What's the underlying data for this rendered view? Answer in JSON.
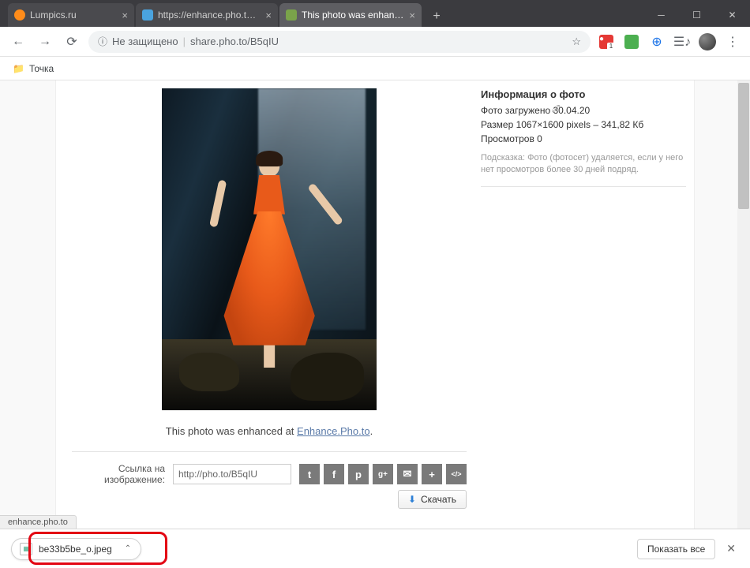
{
  "tabs": [
    {
      "title": "Lumpics.ru",
      "favicon": "#ff8c1a"
    },
    {
      "title": "https://enhance.pho.to/ru/",
      "favicon": "#4aa3df"
    },
    {
      "title": "This photo was enhanced at Enh…",
      "favicon": "#7aa34a",
      "active": true
    }
  ],
  "addressbar": {
    "insecure_label": "Не защищено",
    "url_display": "share.pho.to/B5qIU"
  },
  "bookmarks": {
    "item1": "Точка"
  },
  "page": {
    "caption_prefix": "This photo was enhanced at ",
    "caption_link": "Enhance.Pho.to",
    "share_label": "Ссылка на изображение:",
    "share_url": "http://pho.to/B5qIU",
    "download_btn": "Скачать",
    "expand_glyph": "⤢"
  },
  "sidebar": {
    "title": "Информация о фото",
    "uploaded": "Фото загружено 30.04.20",
    "size": "Размер 1067×1600 pixels – 341,82 Кб",
    "views": "Просмотров 0",
    "hint": "Подсказка: Фото (фотосет) удаляется, если у него нет просмотров более 30 дней подряд."
  },
  "status_hover": "enhance.pho.to",
  "download_bar": {
    "filename": "be33b5be_o.jpeg",
    "show_all": "Показать все"
  },
  "share_icons": {
    "twitter": "t",
    "facebook": "f",
    "pinterest": "p",
    "gplus": "g+",
    "email": "✉",
    "more": "+",
    "embed": "</>"
  }
}
